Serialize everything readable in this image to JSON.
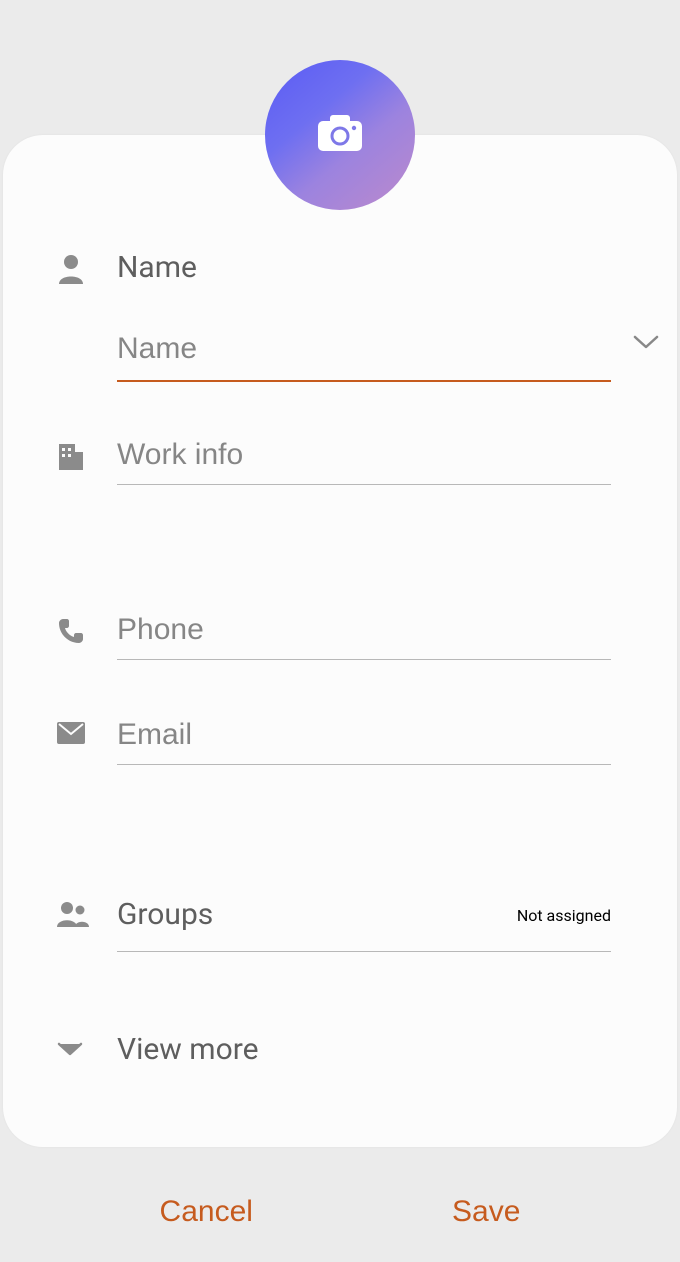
{
  "colors": {
    "accent": "#c65b1e",
    "text_muted": "#5e5e5e",
    "placeholder": "#868686",
    "icon": "#8b8b8b"
  },
  "avatar": {
    "icon": "camera-icon"
  },
  "fields": {
    "name": {
      "label": "Name",
      "placeholder": "Name",
      "value": ""
    },
    "work": {
      "placeholder": "Work info",
      "value": ""
    },
    "phone": {
      "placeholder": "Phone",
      "value": ""
    },
    "email": {
      "placeholder": "Email",
      "value": ""
    },
    "groups": {
      "label": "Groups",
      "value": "Not assigned"
    }
  },
  "view_more": "View more",
  "buttons": {
    "cancel": "Cancel",
    "save": "Save"
  }
}
